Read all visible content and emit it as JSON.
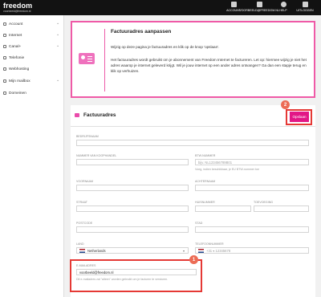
{
  "brand": {
    "name": "freedom",
    "sub": "voorbeeld@freedom.nl"
  },
  "topnav": [
    {
      "label": "ACCOUNT",
      "icon": "user-icon"
    },
    {
      "label": "VOORBEELD@FREEDOM.NL",
      "icon": "mail-icon"
    },
    {
      "label": "HELP",
      "icon": "help-icon"
    },
    {
      "label": "UITLOGGEN",
      "icon": "logout-icon"
    }
  ],
  "sidebar": {
    "items": [
      {
        "label": "Account",
        "chevron": "⌄"
      },
      {
        "label": "Internet",
        "chevron": "⌄"
      },
      {
        "label": "Canal+",
        "chevron": "⌄"
      },
      {
        "label": "Telefonie",
        "chevron": ""
      },
      {
        "label": "Webhosting",
        "chevron": ""
      },
      {
        "label": "Mijn mailbox",
        "chevron": "⌄"
      },
      {
        "label": "Domeinen",
        "chevron": ""
      }
    ]
  },
  "info": {
    "title": "Factuuradres aanpassen",
    "p1": "Wijzig op deze pagina je factuuradres en klik op de knop 'opslaan'.",
    "p2": "Het factuuradres wordt gebruikt om je abonnement van Freedom Internet te factureren. Let op: hiermee wijzig je niet het adres waarop je internet geleverd krijgt. Wil je jouw internet op een ander adres ontvangen? Ga dan een stapje terug en klik op verhuizen."
  },
  "form": {
    "title": "Factuuradres",
    "save_label": "Opslaan",
    "fields": {
      "bedrijfsnaam": {
        "label": "BEDRIJFSNAAM",
        "value": ""
      },
      "kvk": {
        "label": "NUMMER VAN KOOPHANDEL",
        "value": ""
      },
      "btw": {
        "label": "BTW-NUMMER",
        "placeholder": "bijv. NL123456789B01",
        "hint": "Voeg, indien beschikbaar, je EU BTW-nummer toe"
      },
      "voornaam": {
        "label": "VOORNAAM",
        "value": ""
      },
      "achternaam": {
        "label": "ACHTERNAAM",
        "value": ""
      },
      "straat": {
        "label": "STRAAT",
        "value": ""
      },
      "huisnummer": {
        "label": "HUISNUMMER",
        "value": ""
      },
      "toevoeging": {
        "label": "TOEVOEGING",
        "value": ""
      },
      "postcode": {
        "label": "POSTCODE",
        "value": ""
      },
      "stad": {
        "label": "STAD",
        "value": ""
      },
      "land": {
        "label": "LAND",
        "value": "Netherlands"
      },
      "telefoon": {
        "label": "TELEFOONNUMMER",
        "placeholder": "+31 ▾ 12345678"
      },
      "email": {
        "label": "E-MAILADRES",
        "value": "voorbeeld@freedom.nl",
        "hint": "Dit e-mailadres zal \"alleen\" worden gebruikt om je facturen te versturen."
      }
    }
  },
  "annotations": {
    "badge1": "1",
    "badge2": "2"
  },
  "colors": {
    "accent": "#e21786",
    "topbar": "#121212",
    "highlight": "#e53935"
  }
}
